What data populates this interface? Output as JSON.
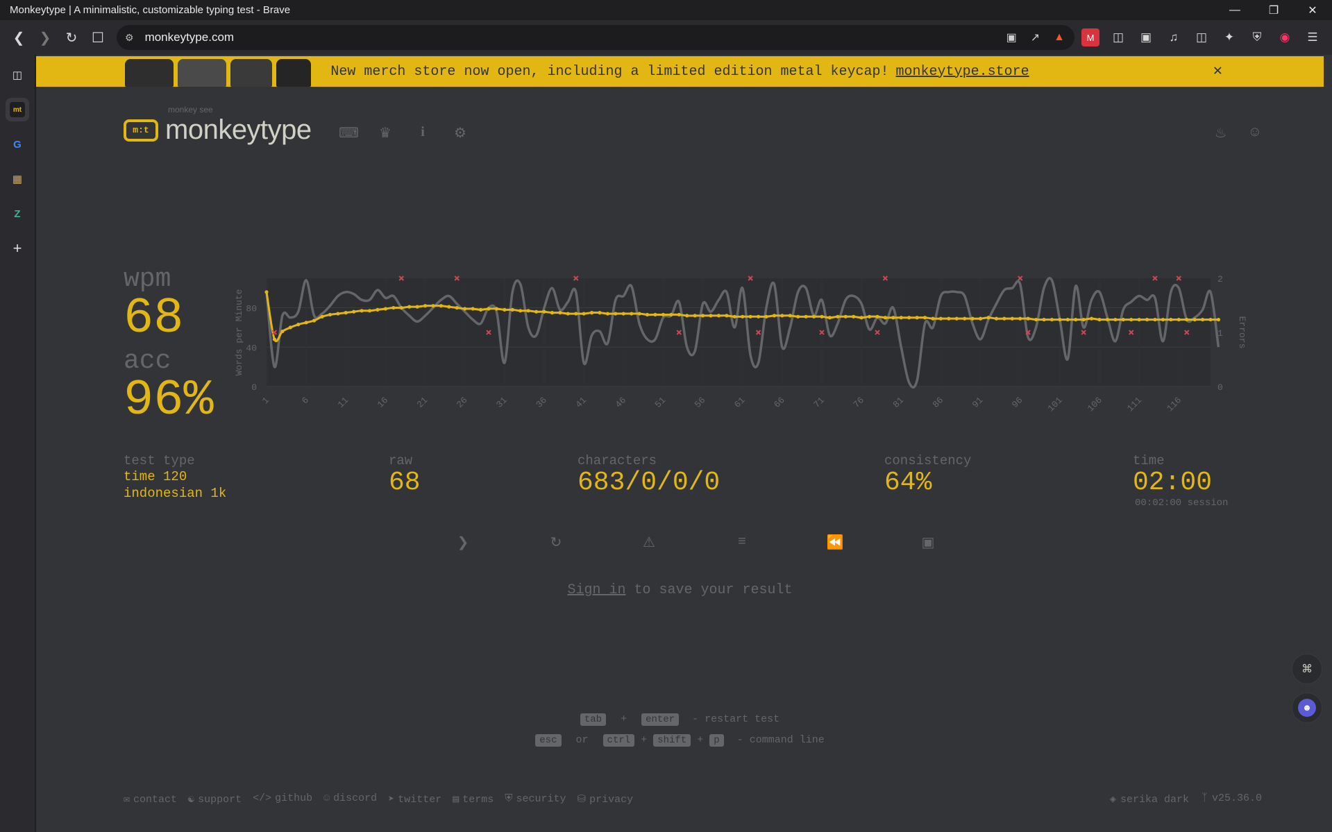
{
  "window": {
    "title": "Monkeytype | A minimalistic, customizable typing test - Brave"
  },
  "browser": {
    "url": "monkeytype.com"
  },
  "banner": {
    "text": "New merch store now open, including a limited edition metal keycap!",
    "link": "monkeytype.store"
  },
  "logo": {
    "sub": "monkey see",
    "main": "monkeytype",
    "badge": "m:t"
  },
  "results": {
    "wpm_label": "wpm",
    "wpm": "68",
    "acc_label": "acc",
    "acc": "96%",
    "test_type_label": "test type",
    "test_type_line1": "time 120",
    "test_type_line2": "indonesian 1k",
    "raw_label": "raw",
    "raw": "68",
    "characters_label": "characters",
    "characters": "683/0/0/0",
    "consistency_label": "consistency",
    "consistency": "64%",
    "time_label": "time",
    "time": "02:00",
    "session": "00:02:00 session"
  },
  "signin": {
    "link": "Sign in",
    "rest": " to save your result"
  },
  "hints": {
    "k_tab": "tab",
    "plus": "+",
    "k_enter": "enter",
    "restart": "- restart test",
    "k_esc": "esc",
    "or": "or",
    "k_ctrl": "ctrl",
    "k_shift": "shift",
    "k_p": "p",
    "cmd": "- command line"
  },
  "footer": {
    "contact": "contact",
    "support": "support",
    "github": "github",
    "discord": "discord",
    "twitter": "twitter",
    "terms": "terms",
    "security": "security",
    "privacy": "privacy",
    "theme": "serika dark",
    "version": "v25.36.0"
  },
  "colors": {
    "accent": "#e2b714",
    "bg": "#323437",
    "sub": "#646669",
    "error": "#ca4754",
    "raw": "#646669"
  },
  "chart_data": {
    "type": "line",
    "ylabel": "Words per Minute",
    "y2label": "Errors",
    "ylim": [
      0,
      110
    ],
    "y2lim": [
      0,
      2
    ],
    "yticks": [
      "0",
      "40",
      "80"
    ],
    "y2ticks": [
      "0",
      "1",
      "2"
    ],
    "xticks": [
      "1",
      "6",
      "11",
      "16",
      "21",
      "26",
      "31",
      "36",
      "41",
      "46",
      "51",
      "56",
      "61",
      "66",
      "71",
      "76",
      "81",
      "86",
      "91",
      "96",
      "101",
      "106",
      "111",
      "116"
    ],
    "x_count": 120,
    "series": [
      {
        "key": "wpm",
        "color": "#e2b714",
        "values": [
          96,
          48,
          56,
          60,
          63,
          65,
          67,
          71,
          73,
          74,
          75,
          76,
          77,
          77,
          78,
          79,
          80,
          80,
          81,
          81,
          82,
          82,
          82,
          81,
          80,
          79,
          79,
          78,
          79,
          79,
          78,
          78,
          77,
          77,
          76,
          76,
          75,
          75,
          74,
          74,
          74,
          75,
          75,
          74,
          74,
          74,
          74,
          74,
          73,
          73,
          73,
          73,
          73,
          72,
          72,
          72,
          72,
          72,
          72,
          71,
          71,
          71,
          71,
          71,
          72,
          72,
          72,
          71,
          71,
          71,
          71,
          70,
          71,
          71,
          71,
          70,
          71,
          71,
          70,
          70,
          70,
          70,
          70,
          70,
          69,
          69,
          69,
          69,
          69,
          69,
          69,
          70,
          69,
          69,
          69,
          69,
          69,
          68,
          68,
          68,
          68,
          68,
          68,
          68,
          69,
          68,
          68,
          68,
          68,
          68,
          68,
          68,
          68,
          68,
          68,
          68,
          68,
          68,
          68,
          68,
          68
        ]
      },
      {
        "key": "raw",
        "color": "#646669",
        "values": [
          96,
          20,
          72,
          70,
          76,
          108,
          72,
          74,
          82,
          92,
          96,
          94,
          88,
          88,
          98,
          90,
          92,
          80,
          72,
          66,
          72,
          80,
          88,
          92,
          84,
          76,
          68,
          64,
          80,
          76,
          24,
          96,
          104,
          60,
          52,
          80,
          100,
          78,
          86,
          96,
          24,
          52,
          56,
          44,
          88,
          92,
          102,
          64,
          48,
          48,
          70,
          72,
          86,
          40,
          36,
          84,
          76,
          88,
          96,
          60,
          100,
          32,
          24,
          80,
          104,
          40,
          60,
          96,
          100,
          72,
          88,
          52,
          64,
          88,
          92,
          84,
          58,
          70,
          64,
          80,
          40,
          4,
          6,
          64,
          60,
          92,
          96,
          96,
          92,
          64,
          48,
          68,
          84,
          98,
          100,
          104,
          50,
          60,
          100,
          108,
          68,
          28,
          102,
          60,
          88,
          96,
          70,
          46,
          78,
          86,
          92,
          88,
          90,
          46,
          96,
          100,
          68,
          70,
          78,
          96,
          40
        ]
      },
      {
        "key": "errors",
        "color": "#ca4754",
        "type": "points",
        "points": [
          [
            2,
            1
          ],
          [
            18,
            2
          ],
          [
            25,
            2
          ],
          [
            29,
            1
          ],
          [
            40,
            2
          ],
          [
            53,
            1
          ],
          [
            62,
            2
          ],
          [
            63,
            1
          ],
          [
            71,
            1
          ],
          [
            78,
            1
          ],
          [
            79,
            2
          ],
          [
            96,
            2
          ],
          [
            97,
            1
          ],
          [
            104,
            1
          ],
          [
            110,
            1
          ],
          [
            113,
            2
          ],
          [
            116,
            2
          ],
          [
            117,
            1
          ]
        ]
      }
    ]
  }
}
